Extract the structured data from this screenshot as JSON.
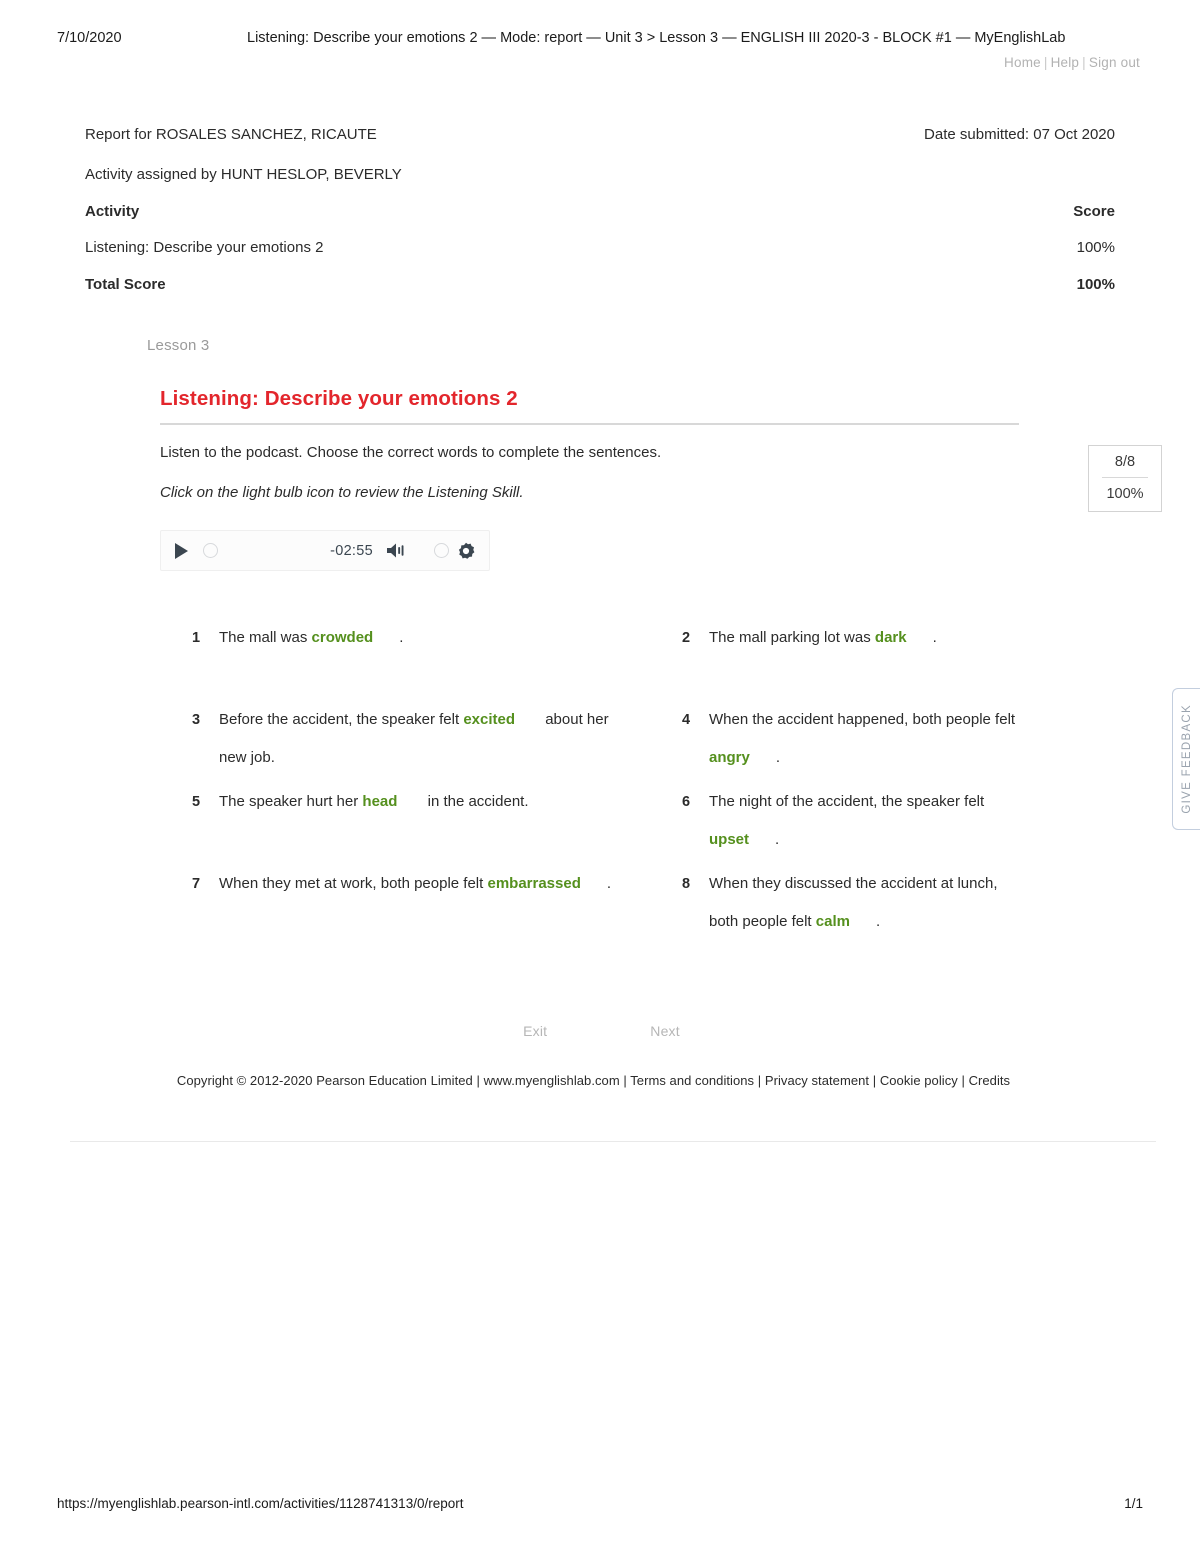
{
  "print_header": {
    "date": "7/10/2020",
    "title": "Listening: Describe your emotions 2 — Mode: report — Unit 3 > Lesson 3 — ENGLISH III 2020-3 - BLOCK #1 — MyEnglishLab"
  },
  "print_footer": {
    "url": "https://myenglishlab.pearson-intl.com/activities/1128741313/0/report",
    "page": "1/1"
  },
  "topnav": {
    "home": "Home",
    "help": "Help",
    "signout": "Sign out",
    "separator": "|"
  },
  "report": {
    "report_for": "Report for ROSALES SANCHEZ, RICAUTE",
    "date_submitted": "Date submitted: 07 Oct 2020",
    "assigned_by": "Activity assigned by HUNT HESLOP, BEVERLY",
    "col_activity": "Activity",
    "col_score": "Score",
    "activity_name": "Listening: Describe your emotions 2",
    "activity_score": "100%",
    "total_label": "Total Score",
    "total_score": "100%"
  },
  "activity": {
    "lesson_label": "Lesson 3",
    "title": "Listening: Describe your emotions 2",
    "instruction": "Listen to the podcast. Choose the correct words to complete the sentences.",
    "instruction_italic": "Click on the light bulb icon to review the Listening Skill.",
    "score_box": {
      "fraction": "8/8",
      "percent": "100%"
    },
    "title_color": "#e3262c",
    "answer_color": "#55901e"
  },
  "audio_player": {
    "time": "-02:55",
    "play_label": "play-button",
    "progress_label": "progress-handle",
    "volume_label": "volume-handle",
    "settings_label": "settings"
  },
  "questions": [
    {
      "num": "1",
      "pre": "The mall was ",
      "answer": "crowded",
      "post": "."
    },
    {
      "num": "2",
      "pre": "The mall parking lot was ",
      "answer": "dark",
      "post": "."
    },
    {
      "num": "3",
      "pre": "Before the accident, the speaker felt ",
      "answer": "excited",
      "post": " about her new job."
    },
    {
      "num": "4",
      "pre": "When the accident happened, both people felt ",
      "answer": "angry",
      "post": "."
    },
    {
      "num": "5",
      "pre": "The speaker hurt her ",
      "answer": "head",
      "post": " in the accident."
    },
    {
      "num": "6",
      "pre": "The night of the accident, the speaker felt ",
      "answer": "upset",
      "post": "."
    },
    {
      "num": "7",
      "pre": "When they met at work, both people felt ",
      "answer": "embarrassed",
      "post": "."
    },
    {
      "num": "8",
      "pre": "When they discussed the accident at lunch, both people felt ",
      "answer": "calm",
      "post": "."
    }
  ],
  "nav": {
    "exit": "Exit",
    "next": "Next"
  },
  "copyright": {
    "text": "Copyright © 2012-2020 Pearson Education Limited |",
    "site": "www.myenglishlab.com",
    "sep": "|",
    "terms": "Terms and conditions",
    "privacy": "Privacy statement",
    "cookie": "Cookie policy",
    "credits": "Credits"
  },
  "feedback_tab": {
    "label": "GIVE FEEDBACK"
  }
}
